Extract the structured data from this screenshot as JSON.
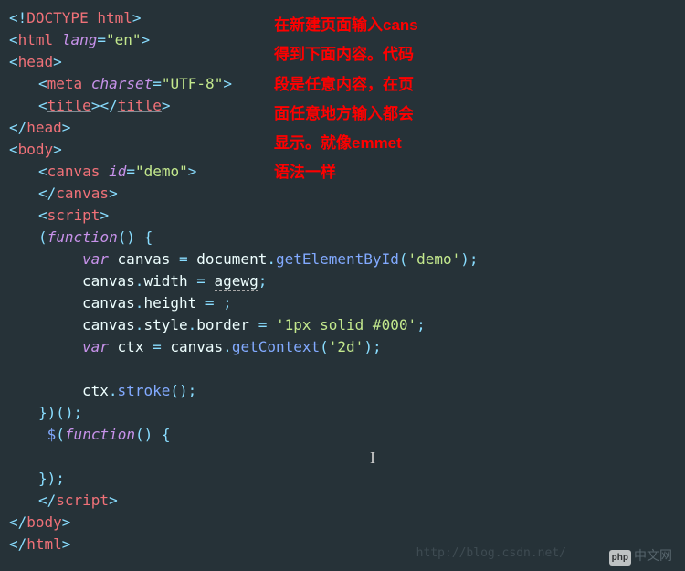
{
  "annotation": {
    "line1": "在新建页面输入cans",
    "line2": "得到下面内容。代码",
    "line3": "段是任意内容，在页",
    "line4": "面任意地方输入都会",
    "line5": "显示。就像emmet",
    "line6": "语法一样"
  },
  "code": {
    "doctype": "<!DOCTYPE html>",
    "html_open_tag": "html",
    "lang_attr": "lang",
    "lang_val": "\"en\"",
    "head_tag": "head",
    "meta_tag": "meta",
    "charset_attr": "charset",
    "charset_val": "\"UTF-8\"",
    "title_tag": "title",
    "body_tag": "body",
    "canvas_tag": "canvas",
    "id_attr": "id",
    "id_val": "\"demo\"",
    "script_tag": "script",
    "function_kw": "function",
    "var_kw": "var",
    "canvas_var": "canvas",
    "document_obj": "document",
    "getElementById": "getElementById",
    "demo_str": "'demo'",
    "width_prop": "width",
    "agewg": "agewg",
    "height_prop": "height",
    "style_prop": "style",
    "border_prop": "border",
    "border_val": "'1px solid #000'",
    "ctx_var": "ctx",
    "getContext": "getContext",
    "ctx_arg": "'2d'",
    "stroke": "stroke",
    "jquery": "$"
  },
  "watermark": {
    "url": "http://blog.csdn.net/",
    "logo_prefix": "php",
    "logo_text": "中文网"
  }
}
